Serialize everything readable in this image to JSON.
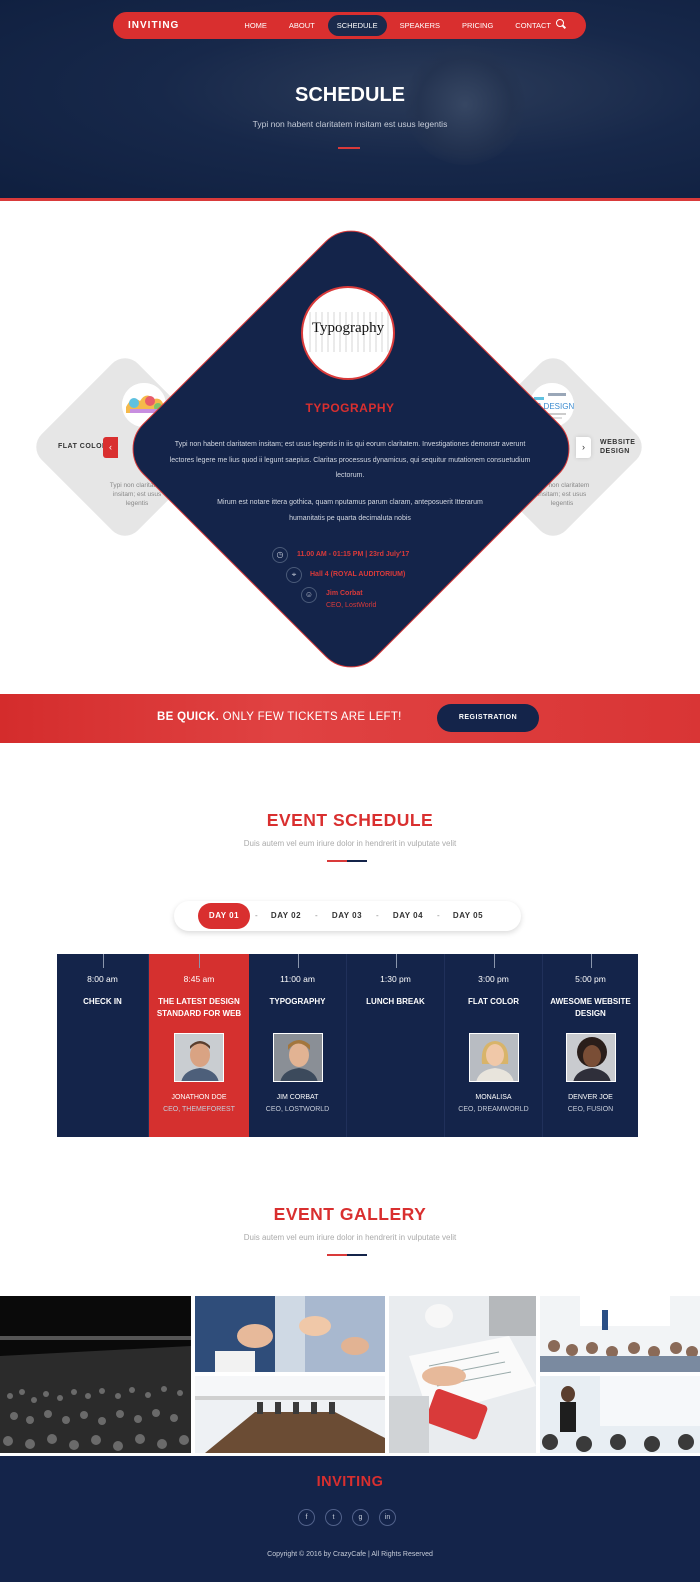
{
  "nav": {
    "brand": "INVITING",
    "items": [
      "HOME",
      "ABOUT",
      "SCHEDULE",
      "SPEAKERS",
      "PRICING",
      "CONTACT"
    ],
    "active": "SCHEDULE",
    "search_icon": "search-icon"
  },
  "hero": {
    "title": "SCHEDULE",
    "subtitle": "Typi non habent claritatem insitam est usus legentis"
  },
  "topics": {
    "left": {
      "title": "FLAT COLOR",
      "desc": "Typi non claritatem insitam; est usus legentis"
    },
    "right": {
      "title_line1": "WEBSITE",
      "title_line2": "DESIGN",
      "desc": "Typi non claritatem insitam; est usus legentis"
    },
    "main": {
      "image_word": "Typography",
      "title": "TYPOGRAPHY",
      "desc1": "Typi non habent claritatem insitam; est usus legentis in iis qui eorum claritatem. Investigationes demonstr averunt lectores legere me lius quod ii legunt saepius. Claritas processus dynamicus, qui sequitur mutationem consuetudium lectorum.",
      "desc2": "Mirum est notare ittera gothica, quam nputamus parum claram, anteposuerit Itterarum humanitatis pe quarta decimaluta nobis",
      "time": "11.00 AM - 01:15 PM  |  23rd July'17",
      "hall": "Hall 4 (ROYAL AUDITORIUM)",
      "speaker": "Jim Corbat",
      "speaker_role": "CEO, LostWorld"
    }
  },
  "banner": {
    "bold": "BE QUICK.",
    "text": " ONLY FEW TICKETS ARE LEFT!",
    "button": "REGISTRATION"
  },
  "event_schedule": {
    "title": "EVENT SCHEDULE",
    "subtitle": "Duis autem vel eum iriure dolor in hendrerit in vulputate velit",
    "days": [
      "DAY  01",
      "DAY  02",
      "DAY  03",
      "DAY  04",
      "DAY  05"
    ],
    "active_day": 0,
    "items": [
      {
        "time": "8:00 am",
        "name": "CHECK IN",
        "person": "",
        "role": ""
      },
      {
        "time": "8:45 am",
        "name": "THE LATEST DESIGN STANDARD FOR WEB",
        "person": "JONATHON DOE",
        "role": "CEO, THEMEFOREST",
        "active": true
      },
      {
        "time": "11:00 am",
        "name": "TYPOGRAPHY",
        "person": "JIM CORBAT",
        "role": "CEO, LOSTWORLD"
      },
      {
        "time": "1:30 pm",
        "name": "LUNCH BREAK",
        "person": "",
        "role": ""
      },
      {
        "time": "3:00 pm",
        "name": "FLAT COLOR",
        "person": "MONALISA",
        "role": "CEO, DREAMWORLD"
      },
      {
        "time": "5:00 pm",
        "name": "AWESOME WEBSITE DESIGN",
        "person": "DENVER JOE",
        "role": "CEO, FUSION"
      }
    ]
  },
  "gallery": {
    "title": "EVENT GALLERY",
    "subtitle": "Duis autem vel eum iriure dolor in hendrerit in vulputate velit"
  },
  "footer": {
    "brand": "INVITING",
    "social": [
      "facebook-icon",
      "twitter-icon",
      "google-plus-icon",
      "linkedin-icon"
    ],
    "social_glyphs": [
      "f",
      "t",
      "g",
      "in"
    ],
    "copyright": "Copyright  © 2016 by CrazyCafe  |  All Rights Reserved"
  },
  "colors": {
    "primary": "#d92f2f",
    "navy": "#14244a"
  }
}
